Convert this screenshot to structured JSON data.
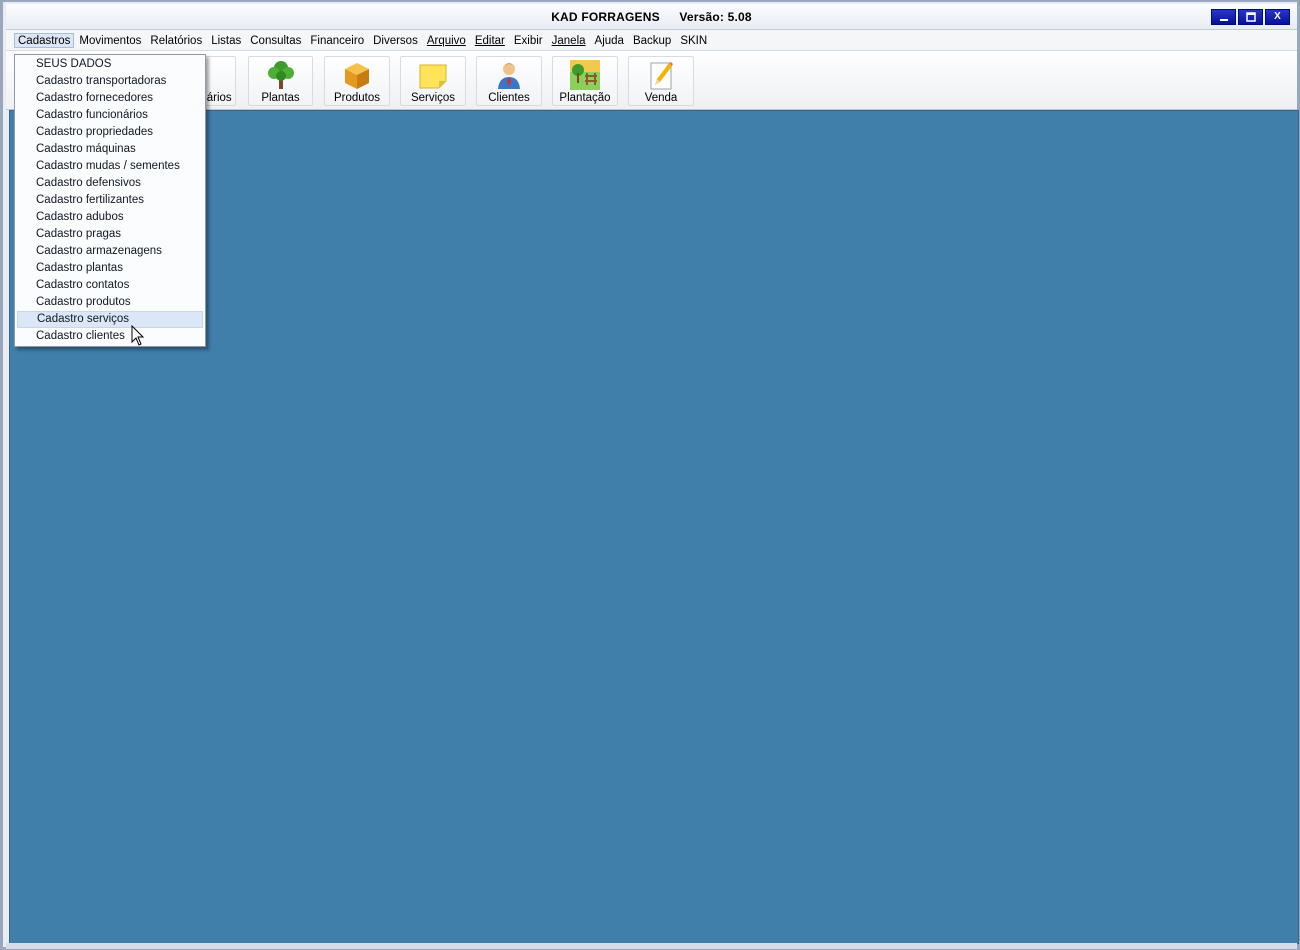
{
  "title": {
    "app": "KAD FORRAGENS",
    "version": "Versão: 5.08"
  },
  "window_controls": {
    "minimize": "▁",
    "maximize": "▣",
    "close": "X"
  },
  "menu": [
    {
      "label": "Cadastros",
      "open": true
    },
    {
      "label": "Movimentos"
    },
    {
      "label": "Relatórios"
    },
    {
      "label": "Listas"
    },
    {
      "label": "Consultas"
    },
    {
      "label": "Financeiro"
    },
    {
      "label": "Diversos"
    },
    {
      "label": "Arquivo"
    },
    {
      "label": "Editar"
    },
    {
      "label": "Exibir"
    },
    {
      "label": "Janela"
    },
    {
      "label": "Ajuda"
    },
    {
      "label": "Backup"
    },
    {
      "label": "SKIN"
    }
  ],
  "toolbar": {
    "hidden_label": "nários",
    "buttons": [
      {
        "label": "Plantas",
        "icon": "tree-icon"
      },
      {
        "label": "Produtos",
        "icon": "box-icon"
      },
      {
        "label": "Serviços",
        "icon": "sticky-note-icon"
      },
      {
        "label": "Clientes",
        "icon": "person-icon"
      },
      {
        "label": "Plantação",
        "icon": "farm-icon"
      },
      {
        "label": "Venda",
        "icon": "pencil-icon"
      }
    ]
  },
  "dropdown": {
    "items": [
      "SEUS DADOS",
      "Cadastro transportadoras",
      "Cadastro fornecedores",
      "Cadastro funcionários",
      "Cadastro propriedades",
      "Cadastro máquinas",
      "Cadastro mudas / sementes",
      "Cadastro defensivos",
      "Cadastro fertilizantes",
      "Cadastro adubos",
      "Cadastro pragas",
      "Cadastro armazenagens",
      "Cadastro plantas",
      "Cadastro contatos",
      "Cadastro produtos",
      "Cadastro serviços",
      "Cadastro clientes"
    ],
    "highlighted": "Cadastro serviços"
  },
  "colors": {
    "workspace": "#3f7faa",
    "highlight": "#dbe6f7",
    "window_button": "#0a14a8"
  }
}
